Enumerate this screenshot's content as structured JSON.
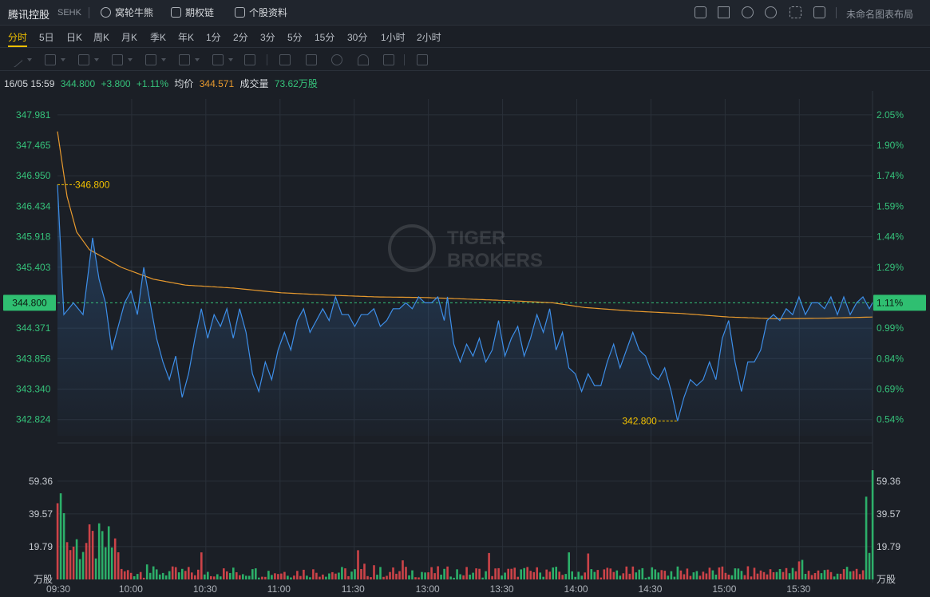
{
  "header": {
    "stock_name": "腾讯控股",
    "exchange": "SEHK",
    "buttons": [
      {
        "label": "窝轮牛熊",
        "icon": "gear-icon"
      },
      {
        "label": "期权链",
        "icon": "chain-icon"
      },
      {
        "label": "个股资料",
        "icon": "document-icon"
      }
    ],
    "tool_icons": [
      "chart-icon",
      "pencil-icon",
      "refresh-icon",
      "settings-icon",
      "fullscreen-icon",
      "grid-layout-icon"
    ],
    "layout_name": "未命名图表布局"
  },
  "periods": [
    "分时",
    "5日",
    "日K",
    "周K",
    "月K",
    "季K",
    "年K",
    "1分",
    "2分",
    "3分",
    "5分",
    "15分",
    "30分",
    "1小时",
    "2小时"
  ],
  "active_period": "分时",
  "drawing_tools": [
    "line-tool-icon",
    "rect-tool-icon",
    "wave-tool-icon",
    "fib-tool-icon",
    "arrow-tool-icon",
    "text-tool-icon",
    "label-tool-icon",
    "measure-tool-icon",
    "brush-icon",
    "lock-icon",
    "eye-icon",
    "magnet-icon",
    "copy-icon",
    "trash-icon"
  ],
  "info": {
    "datetime": "16/05 15:59",
    "price": "344.800",
    "change": "+3.800",
    "change_pct": "+1.11%",
    "avg_label": "均价",
    "avg_value": "344.571",
    "volume_label": "成交量",
    "volume_value": "73.62万股"
  },
  "watermark": {
    "line1": "TIGER",
    "line2": "BROKERS"
  },
  "colors": {
    "background": "#1b1f26",
    "price_line": "#3d8ee8",
    "avg_line": "#e89a2e",
    "up": "#e0474c",
    "down": "#2fbf71",
    "highlight": "#f0c000",
    "axis_green": "#35c27a"
  },
  "chart_data": {
    "type": "line",
    "price_axis": {
      "ticks": [
        "347.981",
        "347.465",
        "346.950",
        "346.434",
        "345.918",
        "345.403",
        "344.371",
        "343.856",
        "343.340",
        "342.824"
      ],
      "range": [
        342.55,
        348.25
      ],
      "current_price_label": "344.800",
      "current_pct_label": "1.11%"
    },
    "pct_axis": {
      "ticks": [
        "2.05%",
        "1.90%",
        "1.74%",
        "1.59%",
        "1.44%",
        "1.29%",
        "0.99%",
        "0.84%",
        "0.69%",
        "0.54%"
      ]
    },
    "volume_axis": {
      "ticks": [
        "59.36",
        "39.57",
        "19.79"
      ],
      "unit": "万股",
      "max": 80
    },
    "time_labels": [
      "09:30",
      "10:00",
      "10:30",
      "11:00",
      "11:30",
      "13:00",
      "13:30",
      "14:00",
      "14:30",
      "15:00",
      "15:30"
    ],
    "annotations": {
      "high_label": "346.800",
      "low_label": "342.800"
    },
    "price_keypoints": [
      [
        0,
        346.8
      ],
      [
        2,
        344.6
      ],
      [
        5,
        344.8
      ],
      [
        8,
        344.6
      ],
      [
        11,
        345.9
      ],
      [
        13,
        345.2
      ],
      [
        15,
        344.8
      ],
      [
        17,
        344.0
      ],
      [
        19,
        344.4
      ],
      [
        21,
        344.8
      ],
      [
        23,
        345.0
      ],
      [
        25,
        344.6
      ],
      [
        27,
        345.4
      ],
      [
        29,
        344.8
      ],
      [
        31,
        344.2
      ],
      [
        33,
        343.8
      ],
      [
        35,
        343.5
      ],
      [
        37,
        343.9
      ],
      [
        39,
        343.2
      ],
      [
        41,
        343.6
      ],
      [
        43,
        344.2
      ],
      [
        45,
        344.7
      ],
      [
        47,
        344.2
      ],
      [
        49,
        344.6
      ],
      [
        51,
        344.4
      ],
      [
        53,
        344.7
      ],
      [
        55,
        344.2
      ],
      [
        57,
        344.7
      ],
      [
        59,
        344.3
      ],
      [
        61,
        343.6
      ],
      [
        63,
        343.3
      ],
      [
        65,
        343.8
      ],
      [
        67,
        343.5
      ],
      [
        69,
        344.0
      ],
      [
        71,
        344.3
      ],
      [
        73,
        344.0
      ],
      [
        75,
        344.5
      ],
      [
        77,
        344.7
      ],
      [
        79,
        344.3
      ],
      [
        81,
        344.5
      ],
      [
        83,
        344.7
      ],
      [
        85,
        344.5
      ],
      [
        87,
        344.9
      ],
      [
        89,
        344.6
      ],
      [
        91,
        344.6
      ],
      [
        93,
        344.4
      ],
      [
        95,
        344.6
      ],
      [
        97,
        344.6
      ],
      [
        99,
        344.7
      ],
      [
        101,
        344.4
      ],
      [
        103,
        344.5
      ],
      [
        105,
        344.7
      ],
      [
        107,
        344.7
      ],
      [
        109,
        344.8
      ],
      [
        111,
        344.7
      ],
      [
        113,
        344.9
      ],
      [
        115,
        344.8
      ],
      [
        117,
        344.8
      ],
      [
        119,
        344.9
      ],
      [
        121,
        344.5
      ],
      [
        122,
        344.9
      ],
      [
        124,
        344.1
      ],
      [
        126,
        343.8
      ],
      [
        128,
        344.1
      ],
      [
        130,
        343.9
      ],
      [
        132,
        344.2
      ],
      [
        134,
        343.8
      ],
      [
        136,
        344.0
      ],
      [
        138,
        344.5
      ],
      [
        140,
        343.9
      ],
      [
        142,
        344.2
      ],
      [
        144,
        344.4
      ],
      [
        146,
        343.9
      ],
      [
        148,
        344.2
      ],
      [
        150,
        344.6
      ],
      [
        152,
        344.3
      ],
      [
        154,
        344.7
      ],
      [
        156,
        344.0
      ],
      [
        158,
        344.3
      ],
      [
        160,
        343.7
      ],
      [
        162,
        343.6
      ],
      [
        164,
        343.3
      ],
      [
        166,
        343.6
      ],
      [
        168,
        343.4
      ],
      [
        170,
        343.4
      ],
      [
        172,
        343.8
      ],
      [
        174,
        344.1
      ],
      [
        176,
        343.7
      ],
      [
        178,
        344.0
      ],
      [
        180,
        344.3
      ],
      [
        182,
        344.0
      ],
      [
        184,
        343.9
      ],
      [
        186,
        343.6
      ],
      [
        188,
        343.5
      ],
      [
        190,
        343.7
      ],
      [
        192,
        343.3
      ],
      [
        194,
        342.8
      ],
      [
        196,
        343.2
      ],
      [
        198,
        343.5
      ],
      [
        200,
        343.4
      ],
      [
        202,
        343.5
      ],
      [
        204,
        343.8
      ],
      [
        206,
        343.5
      ],
      [
        208,
        344.2
      ],
      [
        210,
        344.5
      ],
      [
        212,
        343.8
      ],
      [
        214,
        343.3
      ],
      [
        216,
        343.8
      ],
      [
        218,
        343.8
      ],
      [
        220,
        344.0
      ],
      [
        222,
        344.5
      ],
      [
        224,
        344.6
      ],
      [
        226,
        344.5
      ],
      [
        228,
        344.7
      ],
      [
        230,
        344.6
      ],
      [
        232,
        344.9
      ],
      [
        234,
        344.6
      ],
      [
        236,
        344.8
      ],
      [
        238,
        344.8
      ],
      [
        240,
        344.7
      ],
      [
        242,
        344.9
      ],
      [
        244,
        344.6
      ],
      [
        246,
        344.9
      ],
      [
        248,
        344.6
      ],
      [
        250,
        344.8
      ],
      [
        252,
        344.9
      ],
      [
        254,
        344.7
      ],
      [
        255,
        344.8
      ]
    ],
    "avg_keypoints": [
      [
        0,
        347.7
      ],
      [
        3,
        346.6
      ],
      [
        6,
        346.0
      ],
      [
        10,
        345.7
      ],
      [
        15,
        345.55
      ],
      [
        20,
        345.4
      ],
      [
        25,
        345.3
      ],
      [
        30,
        345.2
      ],
      [
        40,
        345.1
      ],
      [
        55,
        345.05
      ],
      [
        70,
        344.97
      ],
      [
        85,
        344.93
      ],
      [
        100,
        344.9
      ],
      [
        115,
        344.89
      ],
      [
        125,
        344.87
      ],
      [
        140,
        344.84
      ],
      [
        155,
        344.8
      ],
      [
        165,
        344.72
      ],
      [
        180,
        344.66
      ],
      [
        195,
        344.62
      ],
      [
        210,
        344.56
      ],
      [
        225,
        344.53
      ],
      [
        240,
        344.54
      ],
      [
        255,
        344.56
      ]
    ],
    "volume_bars": "generated: per-minute volume bars, larger near the open and a closing-auction spike of about 66 (万股)"
  }
}
